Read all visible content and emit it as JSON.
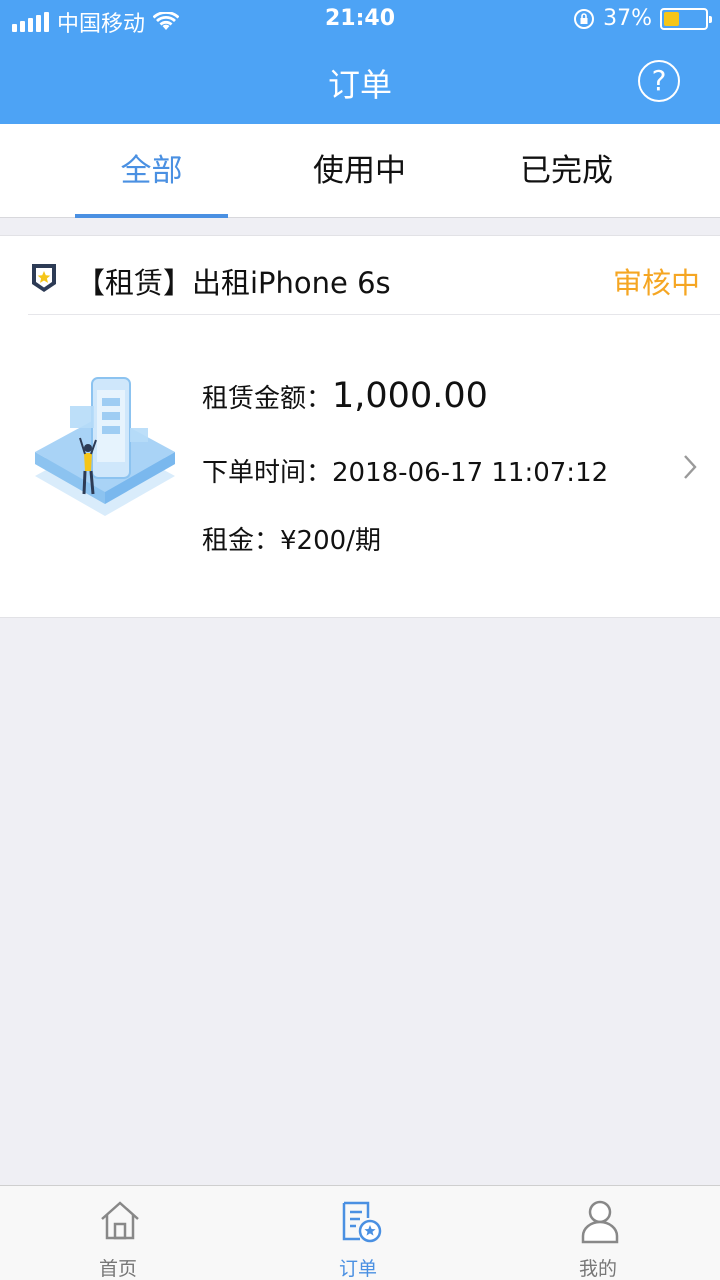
{
  "status_bar": {
    "carrier": "中国移动",
    "time": "21:40",
    "battery": "37%",
    "battery_level": 0.37,
    "icons": [
      "signal-icon",
      "wifi-icon",
      "orientation-lock-icon",
      "battery-icon"
    ]
  },
  "navbar": {
    "title": "订单",
    "help_label": "?"
  },
  "tabs": [
    {
      "label": "全部",
      "active": true
    },
    {
      "label": "使用中",
      "active": false
    },
    {
      "label": "已完成",
      "active": false
    }
  ],
  "order": {
    "title": "【租赁】出租iPhone 6s",
    "status": "审核中",
    "amount_label": "租赁金额：",
    "amount": "1,000.00",
    "time_label": "下单时间：",
    "time": "2018-06-17 11:07:12",
    "rent_label": "租金：",
    "rent": "¥200/期"
  },
  "tabbar": [
    {
      "label": "首页",
      "icon": "home-icon",
      "active": false
    },
    {
      "label": "订单",
      "icon": "order-icon",
      "active": true
    },
    {
      "label": "我的",
      "icon": "profile-icon",
      "active": false
    }
  ],
  "colors": {
    "primary": "#4da3f5",
    "accent": "#4a90e2",
    "status_pending": "#f5a623",
    "background": "#efeff4"
  }
}
